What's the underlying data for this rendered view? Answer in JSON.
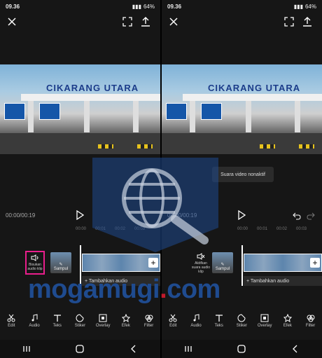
{
  "status_bar": {
    "time": "09.36",
    "battery": "64%"
  },
  "video_sign": "CIKARANG UTARA",
  "timeline": {
    "timecode": "00:00/00:19",
    "ruler": [
      "00:00",
      "00:01",
      "00:02",
      "00:03"
    ]
  },
  "left_panel": {
    "audio_button_label": "Bisukan audio klip",
    "cover_label": "Sampul",
    "add_audio_label": "+ Tambahkan audio"
  },
  "right_panel": {
    "audio_button_label": "Aktifkan suara audio klip",
    "cover_label": "Sampul",
    "add_audio_label": "+ Tambahkan audio",
    "toast": "Suara video nonaktif"
  },
  "toolbar": [
    {
      "label": "Edit",
      "icon": "scissors-icon"
    },
    {
      "label": "Audio",
      "icon": "music-note-icon"
    },
    {
      "label": "Teks",
      "icon": "text-icon"
    },
    {
      "label": "Stiker",
      "icon": "sticker-icon"
    },
    {
      "label": "Overlay",
      "icon": "overlay-icon"
    },
    {
      "label": "Efek",
      "icon": "star-icon"
    },
    {
      "label": "Filter",
      "icon": "filter-icon"
    }
  ],
  "watermark": {
    "brand": "mogamugi",
    "dot": ".",
    "tld": "com"
  },
  "colors": {
    "highlight": "#e91e8c",
    "watermark": "#1f4b8f"
  }
}
